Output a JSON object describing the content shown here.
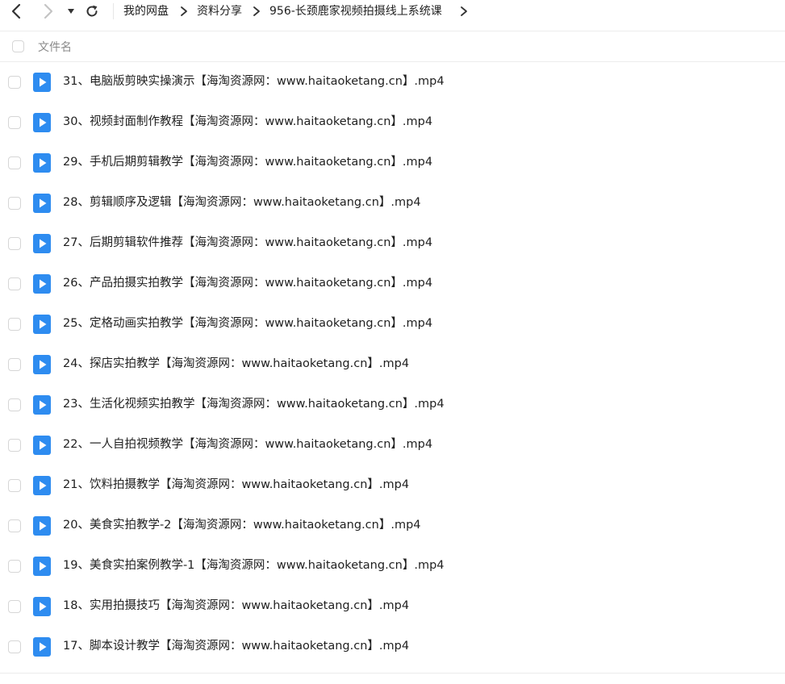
{
  "breadcrumb": {
    "items": [
      {
        "label": "我的网盘"
      },
      {
        "label": "资料分享"
      },
      {
        "label": "956-长颈鹿家视频拍摄线上系统课"
      }
    ]
  },
  "file_table": {
    "columns": [
      {
        "label": "文件名"
      }
    ],
    "files": [
      {
        "name": "31、电脑版剪映实操演示【海淘资源网：www.haitaoketang.cn】.mp4",
        "type": "video-file-icon"
      },
      {
        "name": "30、视频封面制作教程【海淘资源网：www.haitaoketang.cn】.mp4",
        "type": "video-file-icon"
      },
      {
        "name": "29、手机后期剪辑教学【海淘资源网：www.haitaoketang.cn】.mp4",
        "type": "video-file-icon"
      },
      {
        "name": "28、剪辑顺序及逻辑【海淘资源网：www.haitaoketang.cn】.mp4",
        "type": "video-file-icon"
      },
      {
        "name": "27、后期剪辑软件推荐【海淘资源网：www.haitaoketang.cn】.mp4",
        "type": "video-file-icon"
      },
      {
        "name": "26、产品拍摄实拍教学【海淘资源网：www.haitaoketang.cn】.mp4",
        "type": "video-file-icon"
      },
      {
        "name": "25、定格动画实拍教学【海淘资源网：www.haitaoketang.cn】.mp4",
        "type": "video-file-icon"
      },
      {
        "name": "24、探店实拍教学【海淘资源网：www.haitaoketang.cn】.mp4",
        "type": "video-file-icon"
      },
      {
        "name": "23、生活化视频实拍教学【海淘资源网：www.haitaoketang.cn】.mp4",
        "type": "video-file-icon"
      },
      {
        "name": "22、一人自拍视频教学【海淘资源网：www.haitaoketang.cn】.mp4",
        "type": "video-file-icon"
      },
      {
        "name": "21、饮料拍摄教学【海淘资源网：www.haitaoketang.cn】.mp4",
        "type": "video-file-icon"
      },
      {
        "name": "20、美食实拍教学-2【海淘资源网：www.haitaoketang.cn】.mp4",
        "type": "video-file-icon"
      },
      {
        "name": "19、美食实拍案例教学-1【海淘资源网：www.haitaoketang.cn】.mp4",
        "type": "video-file-icon"
      },
      {
        "name": "18、实用拍摄技巧【海淘资源网：www.haitaoketang.cn】.mp4",
        "type": "video-file-icon"
      },
      {
        "name": "17、脚本设计教学【海淘资源网：www.haitaoketang.cn】.mp4",
        "type": "video-file-icon"
      }
    ]
  },
  "colors": {
    "video_icon": "#2e8cf0",
    "text": "#1f1f1f",
    "header_text": "#8a8a8a",
    "divider": "#ececec",
    "checkbox_border": "#d6d6d6"
  }
}
